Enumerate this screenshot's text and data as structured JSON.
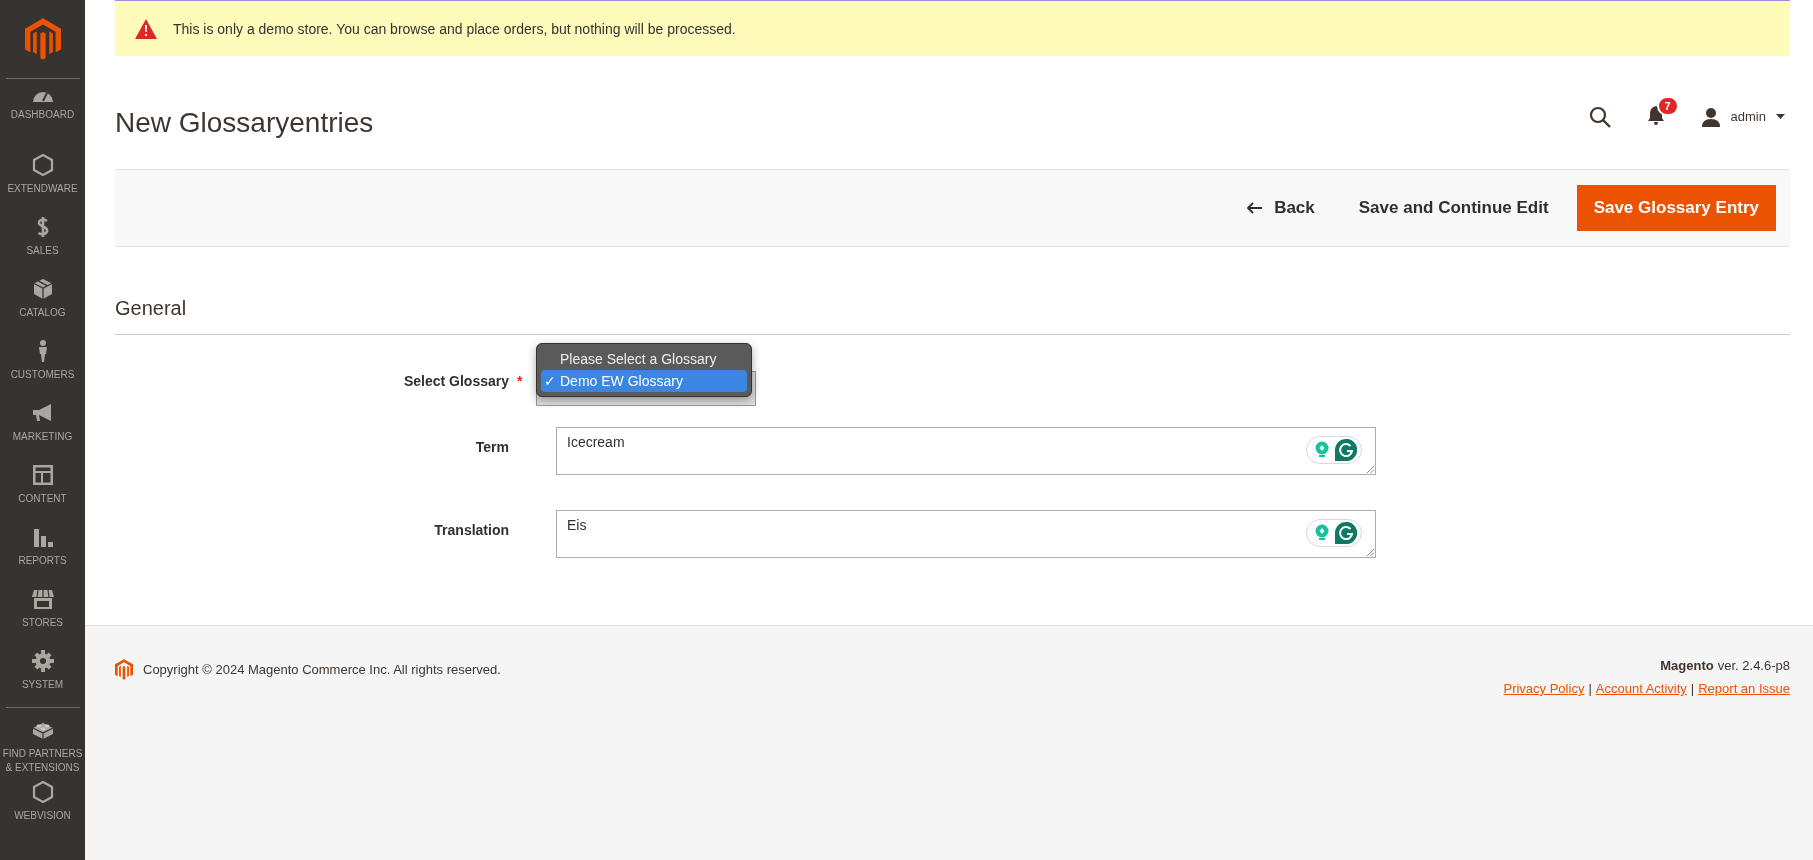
{
  "sidebar": {
    "groups": [
      {
        "items": [
          {
            "label": "DASHBOARD"
          },
          {
            "label": "EXTENDWARE"
          },
          {
            "label": "SALES"
          },
          {
            "label": "CATALOG"
          },
          {
            "label": "CUSTOMERS"
          },
          {
            "label": "MARKETING"
          },
          {
            "label": "CONTENT"
          },
          {
            "label": "REPORTS"
          },
          {
            "label": "STORES"
          },
          {
            "label": "SYSTEM"
          }
        ]
      },
      {
        "items": [
          {
            "label": "FIND PARTNERS & EXTENSIONS"
          },
          {
            "label": "WEBVISION"
          }
        ]
      }
    ]
  },
  "notice": "This is only a demo store. You can browse and place orders, but nothing will be processed.",
  "page_title": "New Glossaryentries",
  "header": {
    "notification_count": "7",
    "user": "admin"
  },
  "actions": [
    {
      "label": "Back",
      "kind": "back"
    },
    {
      "label": "Save and Continue Edit",
      "kind": "plain"
    },
    {
      "label": "Save Glossary Entry",
      "kind": "primary"
    }
  ],
  "section": "General",
  "fields": [
    {
      "label": "Select Glossary",
      "kind": "select",
      "required_mark": "*",
      "options": [
        {
          "label": "Please Select a Glossary",
          "selected": false
        },
        {
          "label": "Demo EW Glossary",
          "selected": true,
          "check": "✓"
        }
      ]
    },
    {
      "label": "Term",
      "kind": "textarea",
      "value": "Icecream"
    },
    {
      "label": "Translation",
      "kind": "textarea",
      "value": "Eis"
    }
  ],
  "footer": {
    "copyright": "Copyright © 2024 Magento Commerce Inc. All rights reserved.",
    "brand": "Magento",
    "version": "ver. 2.4.6-p8",
    "links": [
      {
        "label": "Privacy Policy"
      },
      {
        "separator": "|",
        "label": "Account Activity"
      },
      {
        "separator": "|",
        "label": "Report an Issue"
      }
    ]
  }
}
